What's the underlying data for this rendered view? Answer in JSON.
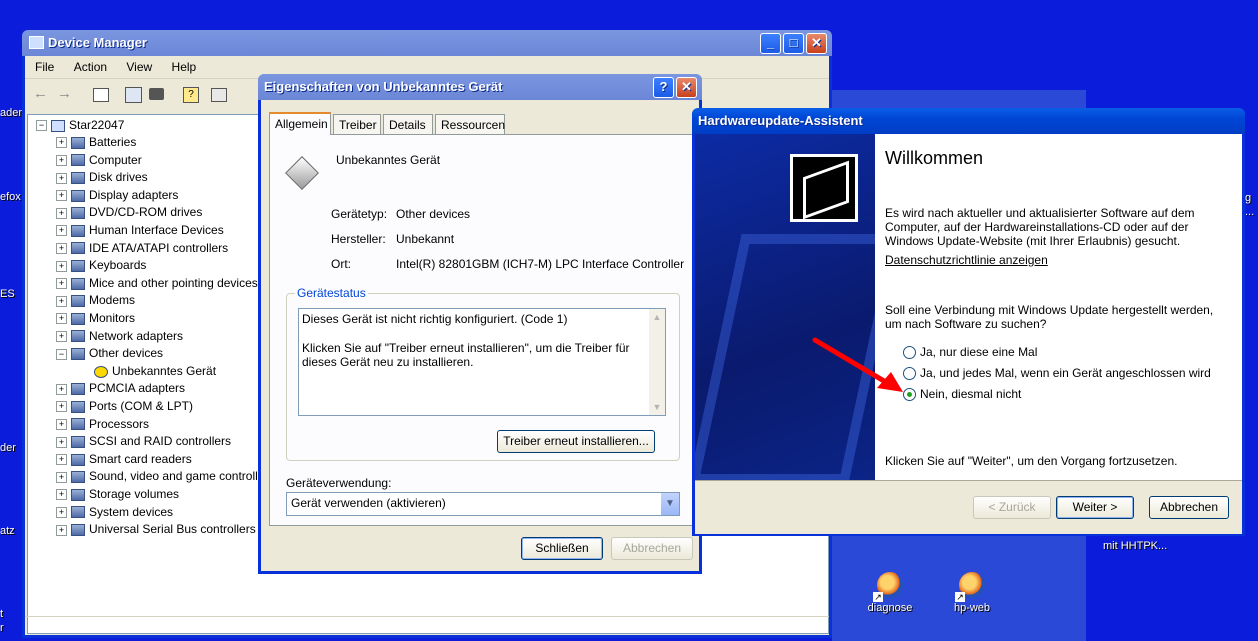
{
  "desktop": {
    "fragments": [
      "ader",
      "efox",
      "ES",
      "der",
      "atz",
      "t",
      "r",
      "g",
      "..."
    ],
    "shortcut_caption": "mit HHTPK...",
    "icons": [
      {
        "label": "diagnose",
        "icon": "firefox-shortcut-icon"
      },
      {
        "label": "hp-web",
        "icon": "firefox-shortcut-icon"
      }
    ]
  },
  "device_manager": {
    "title": "Device Manager",
    "menu": [
      "File",
      "Action",
      "View",
      "Help"
    ],
    "root": "Star22047",
    "categories": [
      {
        "label": "Batteries",
        "expander": "+"
      },
      {
        "label": "Computer",
        "expander": "+"
      },
      {
        "label": "Disk drives",
        "expander": "+"
      },
      {
        "label": "Display adapters",
        "expander": "+"
      },
      {
        "label": "DVD/CD-ROM drives",
        "expander": "+"
      },
      {
        "label": "Human Interface Devices",
        "expander": "+"
      },
      {
        "label": "IDE ATA/ATAPI controllers",
        "expander": "+"
      },
      {
        "label": "Keyboards",
        "expander": "+"
      },
      {
        "label": "Mice and other pointing devices",
        "expander": "+"
      },
      {
        "label": "Modems",
        "expander": "+"
      },
      {
        "label": "Monitors",
        "expander": "+"
      },
      {
        "label": "Network adapters",
        "expander": "+"
      },
      {
        "label": "Other devices",
        "expander": "−"
      },
      {
        "label": "Unbekanntes Gerät",
        "expander": ""
      },
      {
        "label": "PCMCIA adapters",
        "expander": "+"
      },
      {
        "label": "Ports (COM & LPT)",
        "expander": "+"
      },
      {
        "label": "Processors",
        "expander": "+"
      },
      {
        "label": "SCSI and RAID controllers",
        "expander": "+"
      },
      {
        "label": "Smart card readers",
        "expander": "+"
      },
      {
        "label": "Sound, video and game controllers",
        "expander": "+"
      },
      {
        "label": "Storage volumes",
        "expander": "+"
      },
      {
        "label": "System devices",
        "expander": "+"
      },
      {
        "label": "Universal Serial Bus controllers",
        "expander": "+"
      }
    ]
  },
  "properties": {
    "title": "Eigenschaften von Unbekanntes Gerät",
    "help_btn": "?",
    "tabs": [
      "Allgemein",
      "Treiber",
      "Details",
      "Ressourcen"
    ],
    "device_name": "Unbekanntes Gerät",
    "type_label": "Gerätetyp:",
    "type_value": "Other devices",
    "mfr_label": "Hersteller:",
    "mfr_value": "Unbekannt",
    "loc_label": "Ort:",
    "loc_value": "Intel(R) 82801GBM (ICH7-M) LPC Interface Controller -",
    "status_label": "Gerätestatus",
    "status_line1": "Dieses Gerät ist nicht richtig konfiguriert. (Code 1)",
    "status_line2": "Klicken Sie auf \"Treiber erneut installieren\", um die Treiber für dieses Gerät neu zu installieren.",
    "reinstall_btn": "Treiber erneut installieren...",
    "usage_label": "Geräteverwendung:",
    "usage_value": "Gerät verwenden (aktivieren)",
    "close_btn": "Schließen",
    "cancel_btn": "Abbrechen"
  },
  "wizard": {
    "title": "Hardwareupdate-Assistent",
    "heading": "Willkommen",
    "intro": "Es wird nach aktueller und aktualisierter Software auf dem Computer, auf der Hardwareinstallations-CD oder auf der Windows Update-Website (mit Ihrer Erlaubnis) gesucht.",
    "privacy_link": "Datenschutzrichtlinie anzeigen",
    "question": "Soll eine Verbindung mit Windows Update hergestellt werden, um nach Software zu suchen?",
    "options": [
      {
        "label": "Ja, nur diese eine Mal",
        "selected": false
      },
      {
        "label": "Ja, und jedes Mal, wenn ein Gerät angeschlossen wird",
        "selected": false
      },
      {
        "label": "Nein, diesmal nicht",
        "selected": true
      }
    ],
    "continue_hint": "Klicken Sie auf \"Weiter\", um den Vorgang fortzusetzen.",
    "back_btn": "< Zurück",
    "next_btn": "Weiter >",
    "cancel_btn": "Abbrechen"
  },
  "colors": {
    "annotation_arrow": "#ff0000",
    "desktop": "#0b1ddb",
    "title_active": "#0046d5"
  }
}
